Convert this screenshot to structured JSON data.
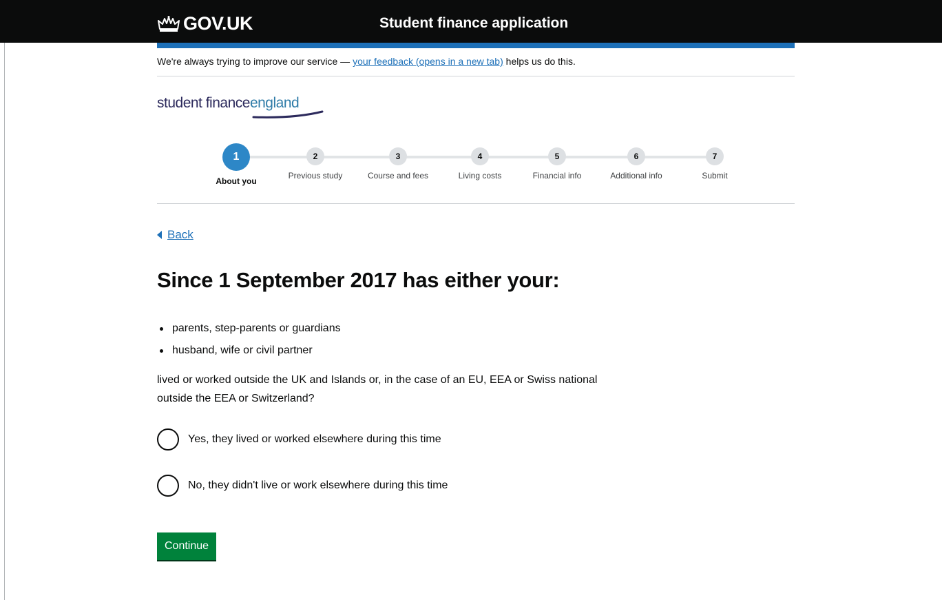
{
  "header": {
    "logo_text": "GOV.UK",
    "service_name": "Student finance application",
    "brand_color": "#0b0c0c",
    "accent_color": "#1d70b8"
  },
  "feedback_banner": {
    "prefix": "We're always trying to improve our service — ",
    "link_text": "your feedback (opens in a new tab)",
    "suffix": " helps us do this."
  },
  "sfe_logo": {
    "word1": "student finance",
    "word2": "england"
  },
  "steps": [
    {
      "number": "1",
      "label": "About you",
      "active": true
    },
    {
      "number": "2",
      "label": "Previous study",
      "active": false
    },
    {
      "number": "3",
      "label": "Course and fees",
      "active": false
    },
    {
      "number": "4",
      "label": "Living costs",
      "active": false
    },
    {
      "number": "5",
      "label": "Financial info",
      "active": false
    },
    {
      "number": "6",
      "label": "Additional info",
      "active": false
    },
    {
      "number": "7",
      "label": "Submit",
      "active": false
    }
  ],
  "back_link": "Back",
  "question": {
    "heading": "Since 1 September 2017 has either your:",
    "bullets": [
      "parents, step-parents or guardians",
      "husband, wife or civil partner"
    ],
    "paragraph": "lived or worked outside the UK and Islands or, in the case of an EU, EEA or Swiss national outside the EEA or Switzerland?"
  },
  "options": [
    {
      "label": "Yes, they lived or worked elsewhere during this time",
      "selected": false
    },
    {
      "label": "No, they didn't live or work elsewhere during this time",
      "selected": false
    }
  ],
  "continue_button": "Continue",
  "button_color": "#00823b"
}
